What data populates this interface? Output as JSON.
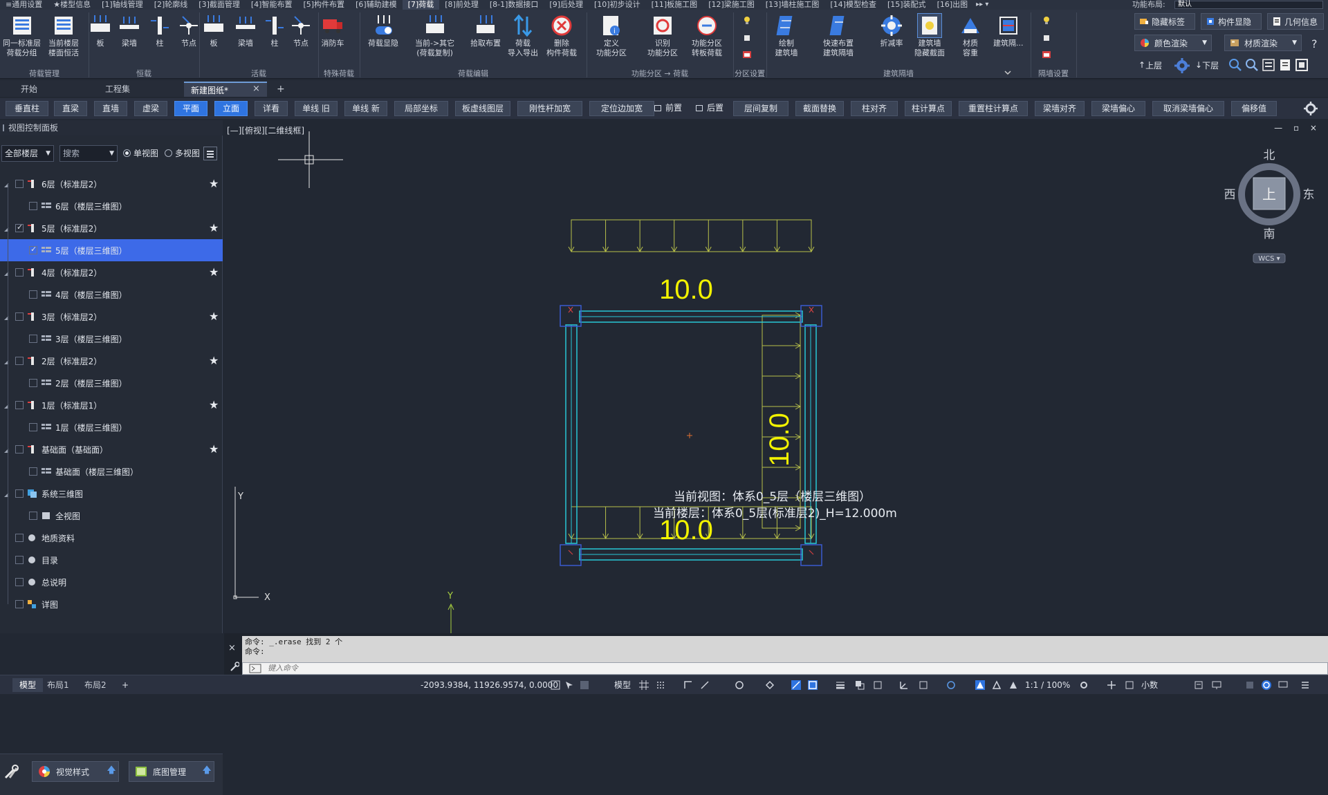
{
  "menu": {
    "tabs": [
      "≡通用设置",
      "★楼型信息",
      "[1]轴线管理",
      "[2]轮廓线",
      "[3]截面管理",
      "[4]智能布置",
      "[5]构件布置",
      "[6]辅助建模",
      "[7]荷载",
      "[8]前处理",
      "[8-1]数据接口",
      "[9]后处理",
      "[10]初步设计",
      "[11]板施工图",
      "[12]梁施工图",
      "[13]墙柱施工图",
      "[14]模型检查",
      "[15]装配式",
      "[16]出图"
    ],
    "active_index": 8,
    "more": "▸▸ ▾",
    "layout_label": "功能布局:",
    "layout_value": "默认"
  },
  "ribbon": {
    "buttons": [
      {
        "label": "同一标准层\n荷载分组"
      },
      {
        "label": "当前楼层\n楼面恒活"
      },
      {
        "label": "板"
      },
      {
        "label": "梁墙"
      },
      {
        "label": "柱"
      },
      {
        "label": "节点"
      },
      {
        "label": "板"
      },
      {
        "label": "梁墙"
      },
      {
        "label": "柱"
      },
      {
        "label": "节点"
      },
      {
        "label": "消防车"
      },
      {
        "label": "荷载显隐"
      },
      {
        "label": "当前->其它\n(荷载复制)"
      },
      {
        "label": "拾取布置"
      },
      {
        "label": "荷载\n导入导出"
      },
      {
        "label": "删除\n构件荷载"
      },
      {
        "label": "定义\n功能分区"
      },
      {
        "label": "识别\n功能分区"
      },
      {
        "label": "功能分区\n转板荷载"
      },
      {
        "label": "绘制\n建筑墙"
      },
      {
        "label": "快速布置\n建筑隔墙"
      },
      {
        "label": "折减率"
      },
      {
        "label": "建筑墙\n隐藏截面"
      },
      {
        "label": "材质\n容重"
      },
      {
        "label": "建筑隔..."
      }
    ],
    "groups": [
      "荷载管理",
      "恒载",
      "活载",
      "特殊荷载",
      "荷载编辑",
      "功能分区 → 荷载",
      "分区设置",
      "建筑隔墙",
      "隔墙设置"
    ],
    "right_buttons": [
      "隐藏标签",
      "构件显隐",
      "几何信息",
      "颜色渲染",
      "材质渲染"
    ],
    "nav": {
      "up": "上层",
      "down": "下层"
    }
  },
  "doc_tabs": [
    "开始",
    "工程集",
    "新建图纸*"
  ],
  "cmd_buttons": [
    "垂直柱",
    "直梁",
    "直墙",
    "虚梁",
    "平面",
    "立面",
    "详看",
    "单线 旧",
    "单线 新",
    "局部坐标",
    "板虚线图层",
    "刚性杆加宽",
    "定位边加宽",
    "前置",
    "后置",
    "层间复制",
    "截面替换",
    "柱对齐",
    "柱计算点",
    "重置柱计算点",
    "梁墙对齐",
    "梁墙偏心",
    "取消梁墙偏心",
    "偏移值"
  ],
  "left_panel": {
    "title": "视图控制面板",
    "floor_filter": "全部楼层",
    "search": "搜索",
    "single_view": "单视图",
    "multi_view": "多视图",
    "tree": [
      {
        "label": "6层（标准层2）",
        "checked": false
      },
      {
        "label": "6层（楼层三维图）",
        "checked": false
      },
      {
        "label": "5层（标准层2）",
        "checked": true
      },
      {
        "label": "5层（楼层三维图）",
        "checked": true
      },
      {
        "label": "4层（标准层2）",
        "checked": false
      },
      {
        "label": "4层（楼层三维图）",
        "checked": false
      },
      {
        "label": "3层（标准层2）",
        "checked": false
      },
      {
        "label": "3层（楼层三维图）",
        "checked": false
      },
      {
        "label": "2层（标准层2）",
        "checked": false
      },
      {
        "label": "2层（楼层三维图）",
        "checked": false
      },
      {
        "label": "1层（标准层1）",
        "checked": false
      },
      {
        "label": "1层（楼层三维图）",
        "checked": false
      },
      {
        "label": "基础面（基础面）",
        "checked": false
      },
      {
        "label": "基础面（楼层三维图）",
        "checked": false
      },
      {
        "label": "系统三维图",
        "checked": false
      },
      {
        "label": "全视图",
        "checked": false
      },
      {
        "label": "地质资料",
        "checked": false
      },
      {
        "label": "目录",
        "checked": false
      },
      {
        "label": "总说明",
        "checked": false
      },
      {
        "label": "详图",
        "checked": false
      }
    ],
    "visual_style": "视觉样式",
    "base_map": "底图管理"
  },
  "viewport": {
    "title": "[—][俯视][二维线框]",
    "controls": "— ▫ ×",
    "load_top": "10.0",
    "load_right": "10.0",
    "load_bottom": "10.0",
    "current_view": "当前视图：体系0_5层（楼层三维图）",
    "current_floor": "当前楼层：体系0_5层(标准层2)_H=12.000m",
    "compass": {
      "n": "北",
      "s": "南",
      "w": "西",
      "e": "东",
      "center": "上",
      "wcs": "WCS ▾"
    },
    "ucs_x": "X",
    "ucs_y": "Y"
  },
  "command": {
    "line1": "命令: _.erase 找到 2 个",
    "line2": "命令:",
    "placeholder": "键入命令"
  },
  "statusbar": {
    "tabs": [
      "模型",
      "布局1",
      "布局2"
    ],
    "add": "+",
    "coords": "-2093.9384, 11926.9574, 0.0000",
    "model": "模型",
    "scale": "1:1 / 100%",
    "units": "小数"
  },
  "colors": {
    "accent": "#2f74e0",
    "load_text": "#f2f200",
    "member": "#28c8d8",
    "load_arrow": "#b8c04a"
  }
}
